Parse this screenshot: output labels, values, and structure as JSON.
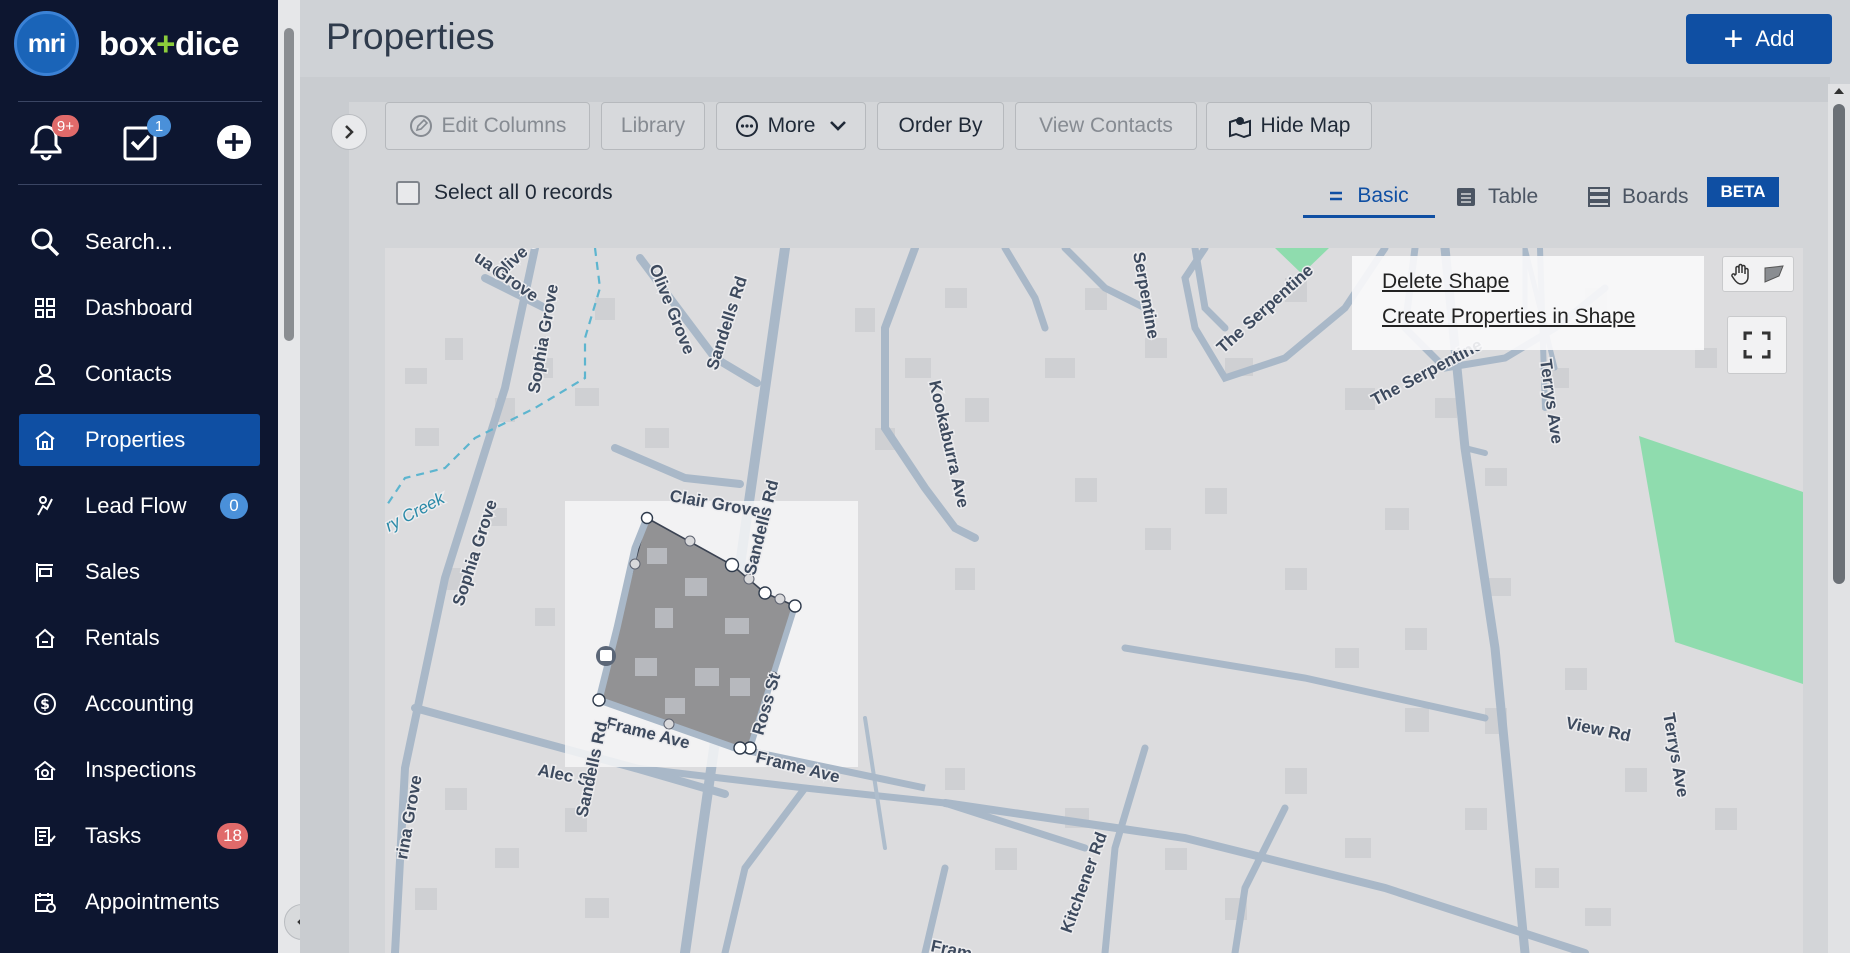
{
  "brand": {
    "logo_mark": "mri",
    "name_left": "box",
    "name_plus": "+",
    "name_right": "dice"
  },
  "quick": {
    "notifications_badge": "9+",
    "tasks_badge": "1"
  },
  "nav": {
    "search_placeholder": "Search...",
    "items": [
      {
        "label": "Dashboard",
        "icon": "grid-icon"
      },
      {
        "label": "Contacts",
        "icon": "person-icon"
      },
      {
        "label": "Properties",
        "icon": "house-icon",
        "active": true
      },
      {
        "label": "Lead Flow",
        "icon": "leadflow-icon",
        "badge": "0"
      },
      {
        "label": "Sales",
        "icon": "sign-icon"
      },
      {
        "label": "Rentals",
        "icon": "rental-home-icon"
      },
      {
        "label": "Accounting",
        "icon": "dollar-icon"
      },
      {
        "label": "Inspections",
        "icon": "inspection-icon"
      },
      {
        "label": "Tasks",
        "icon": "checklist-icon",
        "badge": "18"
      },
      {
        "label": "Appointments",
        "icon": "calendar-icon"
      }
    ]
  },
  "header": {
    "title": "Properties",
    "add_label": "Add"
  },
  "toolbar": {
    "edit_columns": "Edit Columns",
    "library": "Library",
    "more": "More",
    "order_by": "Order By",
    "view_contacts": "View Contacts",
    "hide_map": "Hide Map"
  },
  "selection": {
    "select_all_label": "Select all 0 records"
  },
  "views": {
    "basic": "Basic",
    "table": "Table",
    "boards": "Boards",
    "beta": "BETA"
  },
  "map": {
    "context_menu": {
      "delete_shape": "Delete Shape",
      "create_properties": "Create Properties in Shape"
    },
    "street_labels": {
      "olive_grove_top": "Olive Grove",
      "sandells_rd_top": "Sandells Rd",
      "sophia_grove_top": "Sophia Grove",
      "sophia_grove_bottom": "Sophia Grove",
      "clair_grove": "Clair Grove",
      "sandells_rd_mid": "Sandells Rd",
      "kookaburra_ave": "Kookaburra Ave",
      "the_serpentine_a": "The Serpentine",
      "the_serpentine_b": "The Serpentine",
      "serpentine": "Serpentine",
      "terrys_ave_top": "Terrys Ave",
      "terrys_ave_bottom": "Terrys Ave",
      "view_rd": "View Rd",
      "alec_st": "Alec St",
      "frame_ave_a": "Frame Ave",
      "frame_ave_b": "Frame Ave",
      "ross_st": "Ross St",
      "sandells_rd_bottom": "Sandells Rd",
      "kitchener_rd": "Kitchener Rd",
      "creek": "ry Creek",
      "ua_grove": "ua Grove",
      "olive_g": "Olive G",
      "grove_left": "rina Grove",
      "frame_clip": "Fram"
    },
    "colors": {
      "park": "#8fdcae",
      "road": "#a9b8c8",
      "shape_fill": "#8a8a8c"
    }
  },
  "colors": {
    "sidebar_bg": "#0d1630",
    "primary": "#0f4fa3",
    "badge_red": "#e06a6a",
    "badge_blue": "#4a90d9"
  }
}
